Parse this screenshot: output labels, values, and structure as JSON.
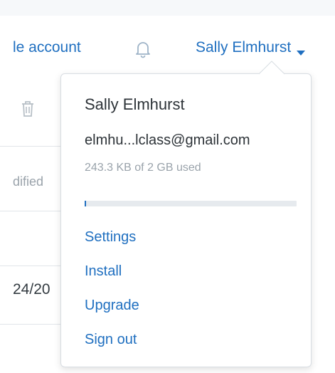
{
  "header": {
    "account_link_label": "le account",
    "user_name": "Sally Elmhurst"
  },
  "background": {
    "column_header": "dified",
    "row_date": "24/20"
  },
  "user_menu": {
    "name": "Sally Elmhurst",
    "email": "elmhu...lclass@gmail.com",
    "usage_text": "243.3 KB of 2 GB used",
    "usage_fraction": 0.0001,
    "items": [
      {
        "label": "Settings"
      },
      {
        "label": "Install"
      },
      {
        "label": "Upgrade"
      },
      {
        "label": "Sign out"
      }
    ]
  },
  "colors": {
    "accent": "#1f6fc0",
    "muted_text": "#9aa3ab",
    "strip": "#f6f8fa"
  },
  "icons": [
    "bell-icon",
    "caret-down-icon",
    "trash-icon"
  ]
}
